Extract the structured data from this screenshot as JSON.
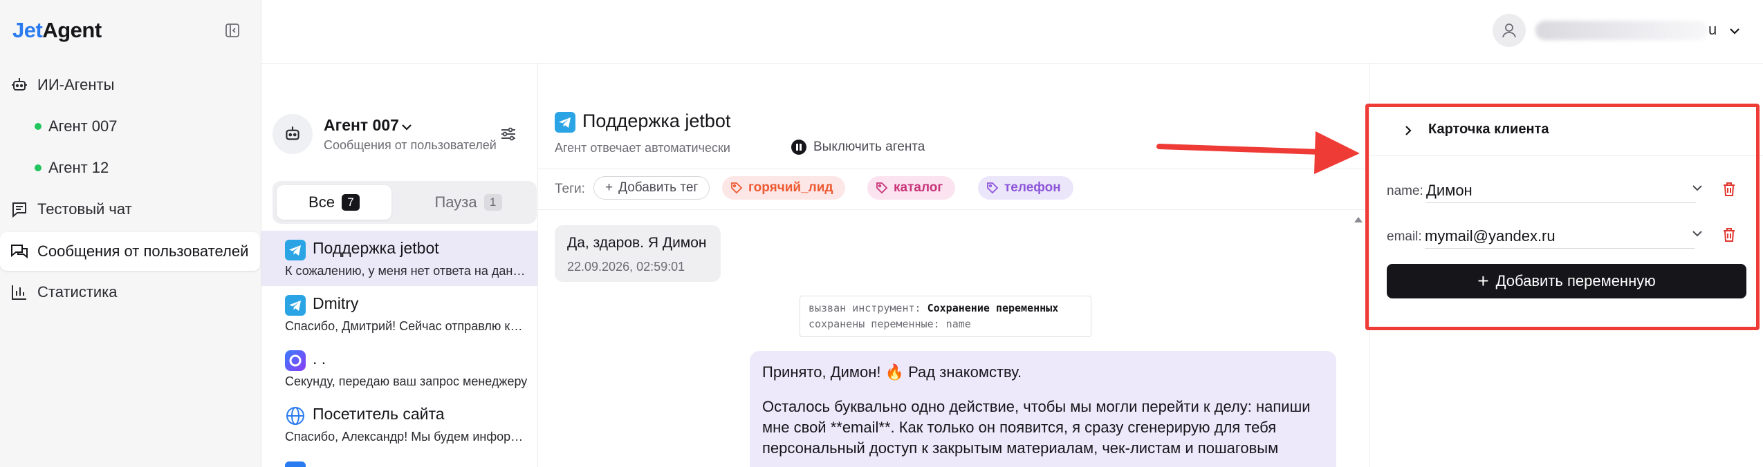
{
  "app": {
    "logo_part1": "Jet",
    "logo_part2": "Agent"
  },
  "sidebar": {
    "items": [
      {
        "label": "ИИ-Агенты",
        "icon": "robot-icon"
      },
      {
        "label": "Агент 007",
        "icon": "status-dot"
      },
      {
        "label": "Агент 12",
        "icon": "status-dot"
      },
      {
        "label": "Тестовый чат",
        "icon": "chat-icon"
      },
      {
        "label": "Сообщения от пользователей",
        "icon": "messages-icon"
      },
      {
        "label": "Статистика",
        "icon": "stats-icon"
      }
    ],
    "active_index": 4
  },
  "header": {
    "user_suffix": "u"
  },
  "conversations": {
    "agent_name": "Агент 007",
    "agent_subtitle": "Сообщения от пользователей",
    "filters": [
      {
        "label": "Все",
        "count": "7"
      },
      {
        "label": "Пауза",
        "count": "1"
      }
    ],
    "items": [
      {
        "title": "Поддержка jetbot",
        "preview": "К сожалению, у меня нет ответа на данный вопрос",
        "icon": "telegram-icon"
      },
      {
        "title": "Dmitry",
        "preview": "Спасибо, Дмитрий! Сейчас отправлю код доступа",
        "icon": "telegram-icon"
      },
      {
        "title": ". .",
        "preview": "Секунду, передаю ваш запрос менеджеру",
        "icon": "max-icon"
      },
      {
        "title": "Посетитель сайта",
        "preview": "Спасибо, Александр! Мы будем информировать вас",
        "icon": "globe-icon"
      }
    ]
  },
  "chat": {
    "title": "Поддержка jetbot",
    "subtitle": "Агент отвечает автоматически",
    "pause_label": "Выключить агента",
    "tags_label": "Теги:",
    "add_tag_label": "Добавить тег",
    "tags": [
      "горячий_лид",
      "каталог",
      "телефон"
    ],
    "messages": {
      "incoming_text": "Да, здаров. Я Димон",
      "incoming_time": "22.09.2026, 02:59:01",
      "tool_prefix": "вызван инструмент:",
      "tool_name": "Сохранение переменных",
      "tool_saved": "сохранены переменные: name",
      "outgoing_p1": "Принято, Димон! 🔥 Рад знакомству.",
      "outgoing_p2": "Осталось буквально одно действие, чтобы мы могли перейти к делу: напиши мне свой **email**. Как только он появится, я сразу сгенерирую для тебя персональный доступ к закрытым материалам, чек-листам и пошаговым"
    }
  },
  "client_card": {
    "title": "Карточка клиента",
    "variables": [
      {
        "label": "name:",
        "value": "Димон"
      },
      {
        "label": "email:",
        "value": "mymail@yandex.ru"
      }
    ],
    "add_button": "Добавить переменную"
  },
  "colors": {
    "accent": "#2b7bf0",
    "highlight": "#ef3b36",
    "active_conv": "#ebe9f7",
    "outgoing_bubble": "#ede9fb"
  }
}
